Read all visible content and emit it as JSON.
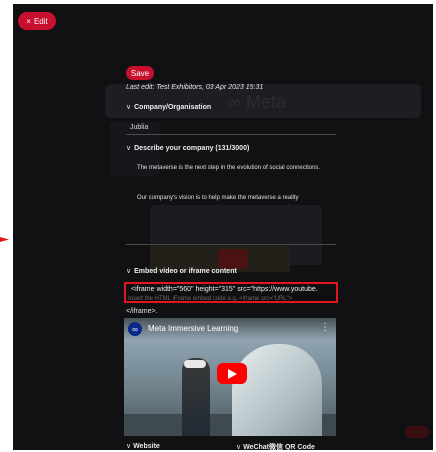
{
  "edit_button": {
    "label": "Edit",
    "icon": "close-icon"
  },
  "form": {
    "save_label": "Save",
    "last_edit": "Last edit: Test Exhibitors, 03 Apr 2023 15:31",
    "company_section": {
      "title": "Company/Organisation",
      "value": "Jublia"
    },
    "describe_section": {
      "title": "Describe your company (131/3000)",
      "line1": "The metaverse is the next step in the evolution of social connections.",
      "line2": "Our company's vision is to help make the metaverse a reality"
    },
    "embed_section": {
      "title": "Embed video or iframe content",
      "code_value": "<iframe width=\"560\" height=\"315\" src=\"https://www.youtube.",
      "placeholder": "Insert the HTML iFrame embed code e.g. <iframe src=\"URL\">",
      "closing_tag": "</iframe>."
    },
    "video": {
      "title": "Meta Immersive Learning"
    },
    "bottom": {
      "website": "Website",
      "wechat": "WeChat微信 QR Code"
    }
  },
  "colors": {
    "accent": "#c8102e",
    "highlight_border": "#e5141e",
    "overlay": "#111113"
  }
}
